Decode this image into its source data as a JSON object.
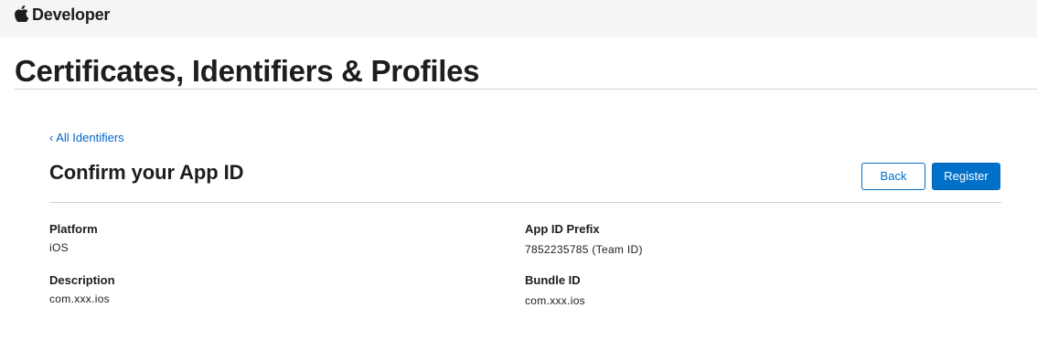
{
  "globalnav": {
    "brand_icon": "apple-icon",
    "brand_label": "Developer"
  },
  "page": {
    "title": "Certificates, Identifiers & Profiles"
  },
  "main": {
    "back_link": "‹ All Identifiers",
    "heading": "Confirm your App ID",
    "buttons": {
      "back_label": "Back",
      "register_label": "Register"
    },
    "fields": {
      "platform": {
        "label": "Platform",
        "value": "iOS"
      },
      "description": {
        "label": "Description",
        "value": "com.xxx.ios"
      },
      "app_id_prefix": {
        "label": "App ID Prefix",
        "value": "7852235785 (Team ID)"
      },
      "bundle_id": {
        "label": "Bundle ID",
        "value": "com.xxx.ios"
      }
    }
  },
  "colors": {
    "accent": "#0070c9",
    "link": "#0066cc",
    "nav_background": "#f5f5f7",
    "divider": "#d2d2d7",
    "text": "#1d1d1f"
  }
}
